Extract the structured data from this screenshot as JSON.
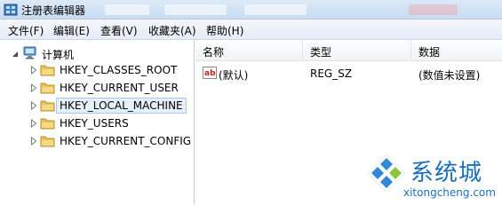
{
  "window": {
    "title": "注册表编辑器"
  },
  "menu": [
    {
      "label": "文件(F)"
    },
    {
      "label": "编辑(E)"
    },
    {
      "label": "查看(V)"
    },
    {
      "label": "收藏夹(A)"
    },
    {
      "label": "帮助(H)"
    }
  ],
  "tree": {
    "root": "计算机",
    "items": [
      {
        "label": "HKEY_CLASSES_ROOT",
        "selected": false
      },
      {
        "label": "HKEY_CURRENT_USER",
        "selected": false
      },
      {
        "label": "HKEY_LOCAL_MACHINE",
        "selected": true
      },
      {
        "label": "HKEY_USERS",
        "selected": false
      },
      {
        "label": "HKEY_CURRENT_CONFIG",
        "selected": false
      }
    ]
  },
  "list": {
    "columns": [
      "名称",
      "类型",
      "数据"
    ],
    "rows": [
      {
        "name": "(默认)",
        "type": "REG_SZ",
        "data": "(数值未设置)",
        "icon": "ab-string-icon"
      }
    ]
  },
  "watermark": {
    "brand": "系统城",
    "url": "xitongcheng.com"
  },
  "colors": {
    "selection": "#e6f0fb",
    "selection_border": "#a9c8ea",
    "folder": "#e8c25a",
    "brand": "#1a6fc0"
  }
}
